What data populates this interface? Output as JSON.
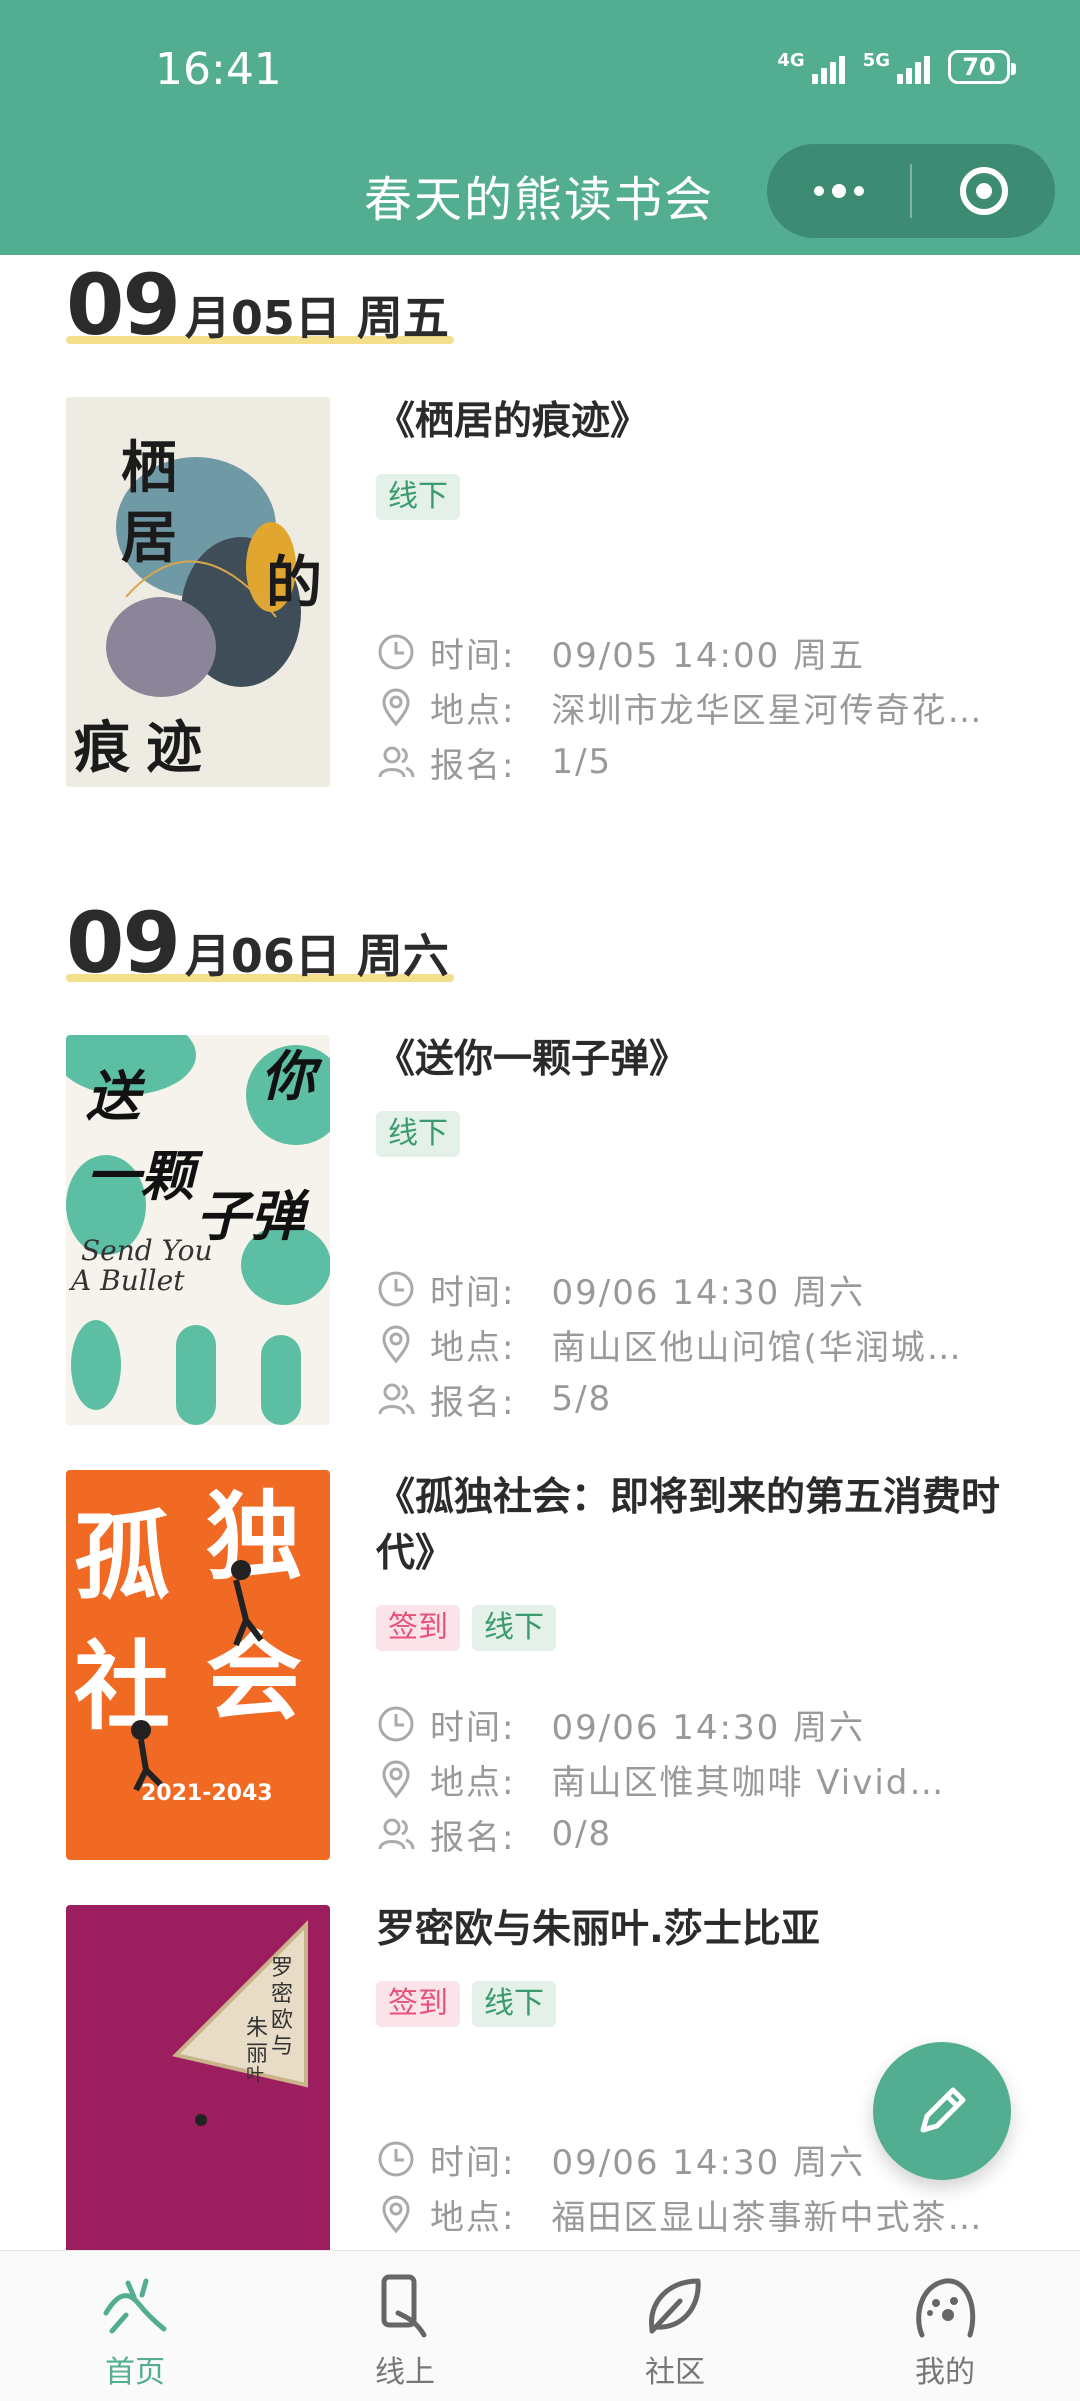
{
  "status": {
    "time": "16:41",
    "net1": "4G",
    "net2": "5G",
    "battery": "70"
  },
  "header": {
    "title": "春天的熊读书会"
  },
  "sections": [
    {
      "date_month": "09",
      "date_rest": "月05日 周五",
      "events": [
        {
          "title": "《栖居的痕迹》",
          "tags": [
            "线下"
          ],
          "cover_text": "栖居的痕迹",
          "time_label": "时间:",
          "time": "09/05 14:00 周五",
          "place_label": "地点:",
          "place": "深圳市龙华区星河传奇花…",
          "signup_label": "报名:",
          "signup": "1/5"
        }
      ]
    },
    {
      "date_month": "09",
      "date_rest": "月06日 周六",
      "events": [
        {
          "title": "《送你一颗子弹》",
          "tags": [
            "线下"
          ],
          "cover_text": "送你一颗子弹",
          "cover_en": "Send You A Bullet",
          "time_label": "时间:",
          "time": "09/06 14:30 周六",
          "place_label": "地点:",
          "place": "南山区他山问馆(华润城…",
          "signup_label": "报名:",
          "signup": "5/8"
        },
        {
          "title": "《孤独社会：即将到来的第五消费时代》",
          "tags": [
            "签到",
            "线下"
          ],
          "cover_text": "孤独社会",
          "cover_year": "2021-2043",
          "time_label": "时间:",
          "time": "09/06 14:30 周六",
          "place_label": "地点:",
          "place": "南山区惟其咖啡 Vivid…",
          "signup_label": "报名:",
          "signup": "0/8"
        },
        {
          "title": "罗密欧与朱丽叶.莎士比亚",
          "tags": [
            "签到",
            "线下"
          ],
          "cover_text": "罗密欧与朱丽叶",
          "time_label": "时间:",
          "time": "09/06 14:30 周六",
          "place_label": "地点:",
          "place": "福田区显山茶事新中式茶…"
        }
      ]
    }
  ],
  "tabs": [
    {
      "label": "首页",
      "icon": "home-icon",
      "active": true
    },
    {
      "label": "线上",
      "icon": "phone-hand-icon",
      "active": false
    },
    {
      "label": "社区",
      "icon": "leaf-icon",
      "active": false
    },
    {
      "label": "我的",
      "icon": "bear-icon",
      "active": false
    }
  ],
  "colors": {
    "primary": "#52ad91",
    "green_tag": "#3c9a6f",
    "pink_tag": "#e4527a",
    "underline": "#f3df8c"
  }
}
